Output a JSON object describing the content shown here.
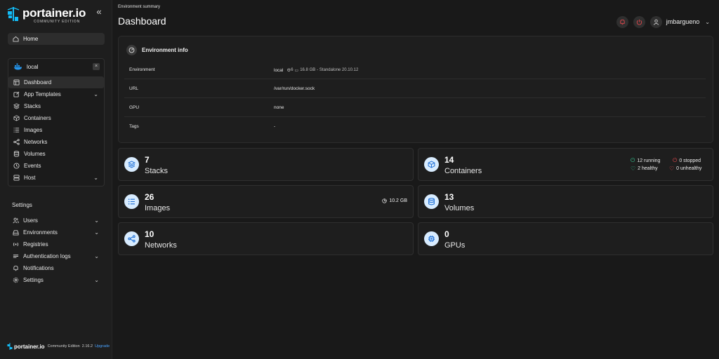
{
  "brand": {
    "name": "portainer.io",
    "edition_tagline": "COMMUNITY EDITION"
  },
  "sidebar": {
    "home_label": "Home",
    "environment": {
      "name": "local",
      "close_label": "×",
      "items": [
        {
          "label": "Dashboard",
          "icon": "layout-icon",
          "active": true
        },
        {
          "label": "App Templates",
          "icon": "edit-icon",
          "expandable": true
        },
        {
          "label": "Stacks",
          "icon": "layers-icon"
        },
        {
          "label": "Containers",
          "icon": "box-icon"
        },
        {
          "label": "Images",
          "icon": "list-icon"
        },
        {
          "label": "Networks",
          "icon": "share-icon"
        },
        {
          "label": "Volumes",
          "icon": "database-icon"
        },
        {
          "label": "Events",
          "icon": "clock-icon"
        },
        {
          "label": "Host",
          "icon": "server-icon",
          "expandable": true
        }
      ]
    },
    "settings_title": "Settings",
    "settings_items": [
      {
        "label": "Users",
        "icon": "users-icon",
        "expandable": true
      },
      {
        "label": "Environments",
        "icon": "hdd-icon",
        "expandable": true
      },
      {
        "label": "Registries",
        "icon": "radio-icon"
      },
      {
        "label": "Authentication logs",
        "icon": "log-icon",
        "expandable": true
      },
      {
        "label": "Notifications",
        "icon": "bell-icon"
      },
      {
        "label": "Settings",
        "icon": "gear-icon",
        "expandable": true
      }
    ],
    "footer": {
      "name": "portainer.io",
      "edition": "Community Edition",
      "version": "2.16.2",
      "upgrade": "Upgrade"
    }
  },
  "header": {
    "breadcrumb": "Environment summary",
    "title": "Dashboard",
    "username": "jmbargueno"
  },
  "env_info": {
    "title": "Environment info",
    "rows": [
      {
        "key": "Environment",
        "value": "local",
        "cpu": "6",
        "memory": "16.8 GB",
        "mode": "- Standalone 20.10.12"
      },
      {
        "key": "URL",
        "value": "/var/run/docker.sock"
      },
      {
        "key": "GPU",
        "value": "none"
      },
      {
        "key": "Tags",
        "value": "-"
      }
    ]
  },
  "tiles": {
    "stacks": {
      "count": "7",
      "label": "Stacks"
    },
    "containers": {
      "count": "14",
      "label": "Containers",
      "running": "12 running",
      "stopped": "0 stopped",
      "healthy": "2 healthy",
      "unhealthy": "0 unhealthy"
    },
    "images": {
      "count": "26",
      "label": "Images",
      "size": "10.2 GB"
    },
    "volumes": {
      "count": "13",
      "label": "Volumes"
    },
    "networks": {
      "count": "10",
      "label": "Networks"
    },
    "gpus": {
      "count": "0",
      "label": "GPUs"
    }
  },
  "colors": {
    "accent_blue": "#4aa3ff",
    "tile_icon_bg": "#d8ecff",
    "running_green": "#34c38f",
    "stopped_red": "#e5484d"
  }
}
